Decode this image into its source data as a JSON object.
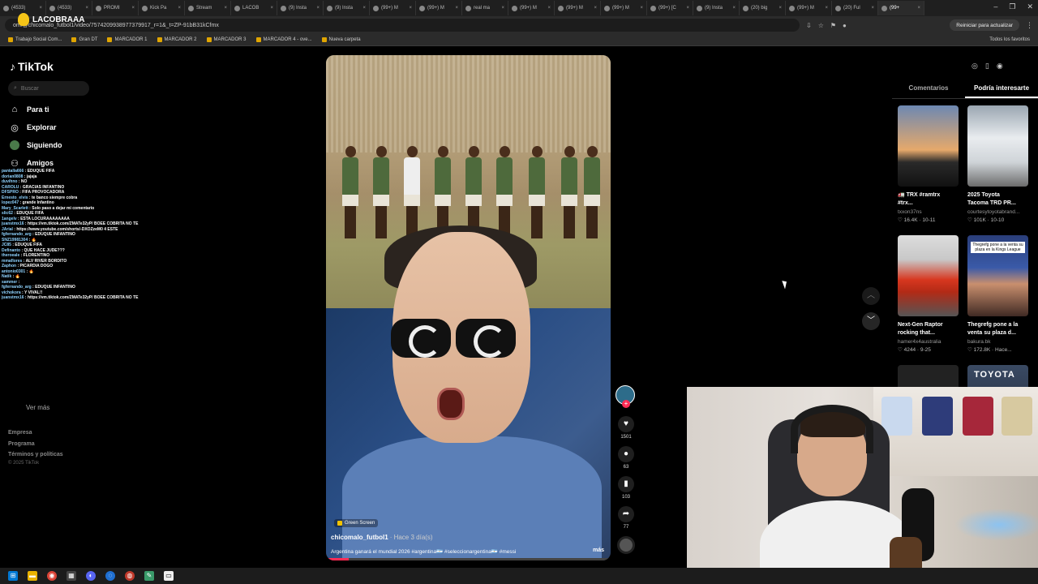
{
  "browser": {
    "tabs": [
      {
        "label": "(4533)",
        "active": false
      },
      {
        "label": "(4533)",
        "active": false
      },
      {
        "label": "PROMI",
        "active": false
      },
      {
        "label": "Kick Pa",
        "active": false
      },
      {
        "label": "Stream",
        "active": false
      },
      {
        "label": "LACOB",
        "active": false
      },
      {
        "label": "(9) Insta",
        "active": false
      },
      {
        "label": "(9) Insta",
        "active": false
      },
      {
        "label": "(99+) M",
        "active": false
      },
      {
        "label": "(99+) M",
        "active": false
      },
      {
        "label": "real ma",
        "active": false
      },
      {
        "label": "(99+) M",
        "active": false
      },
      {
        "label": "(99+) M",
        "active": false
      },
      {
        "label": "(99+) M",
        "active": false
      },
      {
        "label": "(99+) [C",
        "active": false
      },
      {
        "label": "(9) Insta",
        "active": false
      },
      {
        "label": "(20) big",
        "active": false
      },
      {
        "label": "(99+) M",
        "active": false
      },
      {
        "label": "(20) Ful",
        "active": false
      },
      {
        "label": "(99+",
        "active": true
      }
    ],
    "url": "om/@chicomalo_futbol1/video/7574209938977379917_r=1&_t=ZP-91bB31kCfmx",
    "update_button": "Reiniciar para actualizar",
    "bookmarks": [
      "Trabajo Social Com...",
      "Gran DT",
      "MARCADOR 1",
      "MARCADOR 2",
      "MARCADOR 3",
      "MARCADOR 4 - ove...",
      "Nueva carpeta"
    ],
    "all_bookmarks": "Todos los favoritos"
  },
  "overlay": {
    "channel": "LACOBRAAA"
  },
  "tiktok": {
    "logo": "TikTok",
    "search_placeholder": "Buscar",
    "nav": [
      {
        "label": "Para ti",
        "icon": "home-icon"
      },
      {
        "label": "Explorar",
        "icon": "compass-icon"
      },
      {
        "label": "Siguiendo",
        "icon": "avatar-icon"
      },
      {
        "label": "Amigos",
        "icon": "friends-icon"
      }
    ],
    "ver_mas": "Ver más",
    "footer": [
      "Empresa",
      "Programa",
      "Términos y políticas"
    ],
    "copyright": "© 2025 TikTok"
  },
  "chat": [
    {
      "user": "pantalla666",
      "msg": "EDUQUE FIFA"
    },
    {
      "user": "dorian0808",
      "msg": "jajaja"
    },
    {
      "user": "duvihno",
      "msg": "NO"
    },
    {
      "user": "CAROLU",
      "msg": "GRACIAS INFANTINO"
    },
    {
      "user": "DFSPRO",
      "msg": "FIFA PROVOCADORA"
    },
    {
      "user": "Ernesto_elvis",
      "msg": "te banco siempre cobra"
    },
    {
      "user": "lopez047",
      "msg": "grande Infantino"
    },
    {
      "user": "Mary_Scarlett",
      "msg": "Solo paso a dejar mi comentario"
    },
    {
      "user": "slic62",
      "msg": "EDUQUE FIFA"
    },
    {
      "user": "1angelv",
      "msg": "ESTA LOCURAAAAAAAA"
    },
    {
      "user": "juanstmx16",
      "msg": "https://vm.tiktok.com/ZMATe32yP/ BOEE COBRITA NO TE VEIA ASI"
    },
    {
      "user": "JArial",
      "msg": "https://www.youtube.com/shorts/-DXOZzeM0 4 ESTE"
    },
    {
      "user": "fgfernando_arg",
      "msg": "EDUQUE INFANTINO"
    },
    {
      "user": "SNZ19981304",
      "msg": "🔥"
    },
    {
      "user": "JC85",
      "msg": "EDUQUE FIFA"
    },
    {
      "user": "Definanto",
      "msg": "QUE HACE JUDE???"
    },
    {
      "user": "theroeale",
      "msg": "FLORENTINO"
    },
    {
      "user": "mmaflores",
      "msg": "ALV RIVER BORDITO"
    },
    {
      "user": "Zaphon",
      "msg": "PICARDIA DOGO"
    },
    {
      "user": "antonio0301",
      "msg": "🔥"
    },
    {
      "user": "Natik",
      "msg": "🔥"
    },
    {
      "user": "sammer",
      "msg": ""
    },
    {
      "user": "fgfernando_arg",
      "msg": "EDUQUE INFANTINO"
    },
    {
      "user": "vichokora",
      "msg": "Y VIVAL!!"
    },
    {
      "user": "juanstmx16",
      "msg": "https://vm.tiktok.com/ZMATe32yP/ BOEE COBRITA NO TE VEIA ASI"
    }
  ],
  "video": {
    "badge": "Green Screen",
    "author": "chicomalo_futbol1",
    "time": "· Hace 3 día(s)",
    "caption": "Argentina ganará el mundial 2026 #argentina🇦🇷 #seleccionargentina🇦🇷 #messi",
    "more": "más",
    "progress": 0.08
  },
  "actions": {
    "likes": "1501",
    "comments": "63",
    "saves": "103",
    "shares": "77"
  },
  "right_panel": {
    "tabs": [
      "Comentarios",
      "Podría interesarte"
    ],
    "active_tab": 1,
    "cards": [
      {
        "title": "🚛 TRX #ramtrx",
        "title2": "#trx...",
        "user": "txxon37ns",
        "meta": "♡ 16.4K · 10-11",
        "thumb": "night-truck"
      },
      {
        "title": "2025 Toyota",
        "title2": "Tacoma TRD PR...",
        "user": "courtesytoyotabrand...",
        "meta": "♡ 101K · 10-10",
        "thumb": "white-truck"
      },
      {
        "title": "Next-Gen Raptor",
        "title2": "rocking that...",
        "user": "hamer4x4australia",
        "meta": "♡ 4244 · 9-25",
        "thumb": "red-truck"
      },
      {
        "title": "Thegrefg pone a la",
        "title2": "venta su plaza d...",
        "user": "bakura.bk",
        "meta": "♡ 172.8K · Hace...",
        "thumb": "streamer"
      },
      {
        "title": "",
        "title2": "",
        "user": "",
        "meta": "",
        "thumb": "dark"
      },
      {
        "title": "",
        "title2": "",
        "user": "",
        "meta": "",
        "thumb": "toyota"
      }
    ],
    "thumb_texts": {
      "streamer": "Thegrefg pone a la venta su plaza en la Kings League",
      "toyota": "TOYOTA"
    }
  },
  "colors": {
    "accent": "#fe2c55",
    "bg": "#000000",
    "muted": "#888888"
  }
}
